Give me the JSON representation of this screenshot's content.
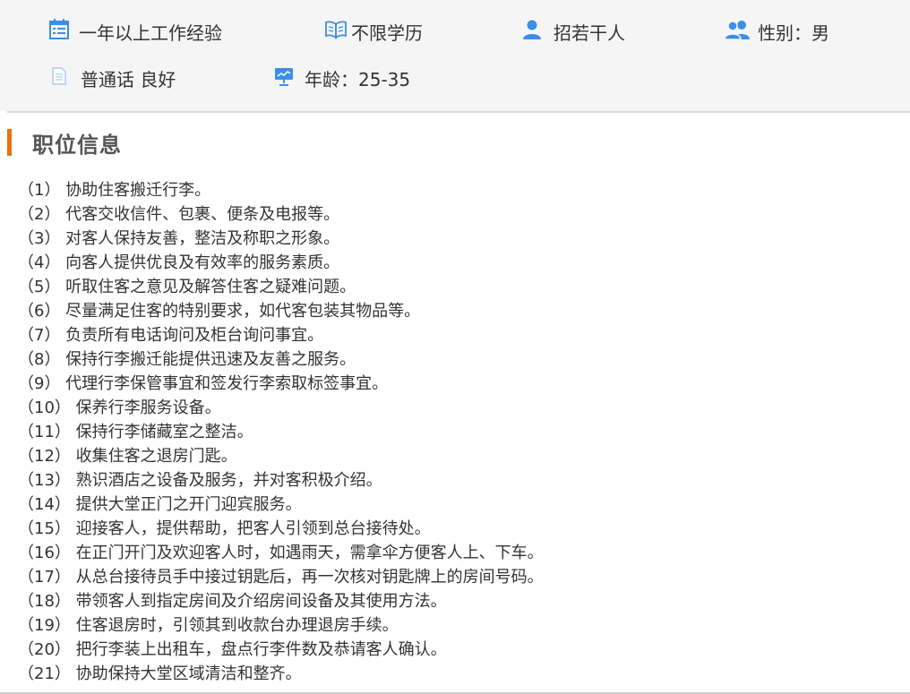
{
  "requirements": {
    "experience": "一年以上工作经验",
    "education": "不限学历",
    "headcount": "招若干人",
    "gender": "性别：男",
    "language": "普通话 良好",
    "age": "年龄：25-35"
  },
  "colors": {
    "accent": "#f06f0c",
    "icon_blue": "#3b8fe6",
    "panel_bg": "#f5f5f5"
  },
  "section": {
    "title": "职位信息"
  },
  "duties": [
    "（1） 协助住客搬迁行李。",
    "（2） 代客交收信件、包裹、便条及电报等。",
    "（3） 对客人保持友善，整洁及称职之形象。",
    "（4） 向客人提供优良及有效率的服务素质。",
    "（5） 听取住客之意见及解答住客之疑难问题。",
    "（6） 尽量满足住客的特别要求，如代客包装其物品等。",
    "（7） 负责所有电话询问及柜台询问事宜。",
    "（8） 保持行李搬迁能提供迅速及友善之服务。",
    "（9） 代理行李保管事宜和签发行李索取标签事宜。",
    "（10） 保养行李服务设备。",
    "（11） 保持行李储藏室之整洁。",
    "（12） 收集住客之退房门匙。",
    "（13） 熟识酒店之设备及服务，并对客积极介绍。",
    "（14） 提供大堂正门之开门迎宾服务。",
    "（15） 迎接客人，提供帮助，把客人引领到总台接待处。",
    "（16） 在正门开门及欢迎客人时，如遇雨天，需拿伞方便客人上、下车。",
    "（17） 从总台接待员手中接过钥匙后，再一次核对钥匙牌上的房间号码。",
    "（18） 带领客人到指定房间及介绍房间设备及其使用方法。",
    "（19） 住客退房时，引领其到收款台办理退房手续。",
    "（20） 把行李装上出租车，盘点行李件数及恭请客人确认。",
    "（21） 协助保持大堂区域清洁和整齐。"
  ]
}
